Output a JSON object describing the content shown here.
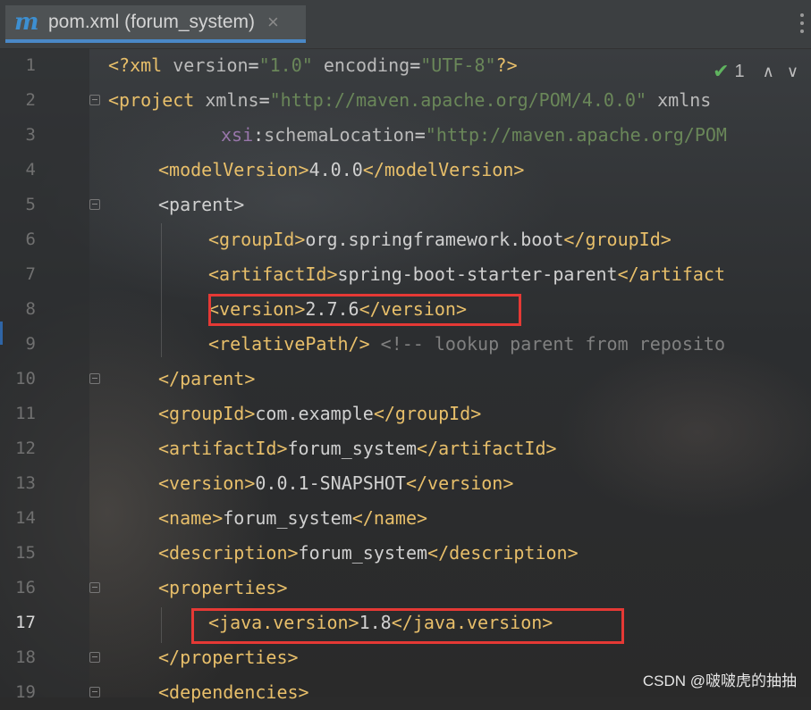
{
  "tab": {
    "title": "pom.xml (forum_system)",
    "close": "×",
    "icon": "maven-icon"
  },
  "inspection": {
    "count": "1",
    "up": "∧",
    "down": "∨"
  },
  "watermark": "CSDN @啵啵虎的抽抽",
  "colors": {
    "accent": "#4a88c7",
    "highlight": "#e53935",
    "tag": "#e8bf6a",
    "string": "#6a8759",
    "namespace": "#9876aa",
    "comment": "#808080"
  },
  "lines": [
    {
      "num": "1",
      "text": "<?xml version=\"1.0\" encoding=\"UTF-8\"?>"
    },
    {
      "num": "2",
      "text": "<project xmlns=\"http://maven.apache.org/POM/4.0.0\" xmlns"
    },
    {
      "num": "3",
      "text": "         xsi:schemaLocation=\"http://maven.apache.org/POM"
    },
    {
      "num": "4",
      "text": "<modelVersion>4.0.0</modelVersion>"
    },
    {
      "num": "5",
      "text": "<parent>"
    },
    {
      "num": "6",
      "text": "<groupId>org.springframework.boot</groupId>"
    },
    {
      "num": "7",
      "text": "<artifactId>spring-boot-starter-parent</artifact"
    },
    {
      "num": "8",
      "text": "<version>2.7.6</version>"
    },
    {
      "num": "9",
      "text": "<relativePath/> <!-- lookup parent from reposito"
    },
    {
      "num": "10",
      "text": "</parent>"
    },
    {
      "num": "11",
      "text": "<groupId>com.example</groupId>"
    },
    {
      "num": "12",
      "text": "<artifactId>forum_system</artifactId>"
    },
    {
      "num": "13",
      "text": "<version>0.0.1-SNAPSHOT</version>"
    },
    {
      "num": "14",
      "text": "<name>forum_system</name>"
    },
    {
      "num": "15",
      "text": "<description>forum_system</description>"
    },
    {
      "num": "16",
      "text": "<properties>"
    },
    {
      "num": "17",
      "text": "<java.version>1.8</java.version>"
    },
    {
      "num": "18",
      "text": "</properties>"
    },
    {
      "num": "19",
      "text": "<dependencies>"
    }
  ]
}
